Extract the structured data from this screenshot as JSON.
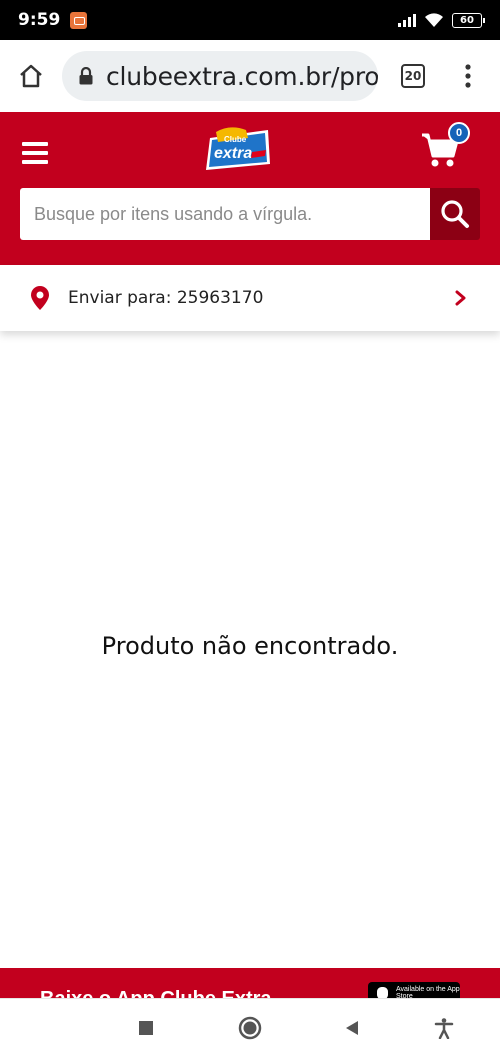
{
  "status_bar": {
    "time": "9:59",
    "battery": "60"
  },
  "browser": {
    "url": "clubeextra.com.br/pro",
    "tab_count": "20"
  },
  "header": {
    "logo_alt": "Clube Extra",
    "cart_count": "0",
    "search_placeholder": "Busque por itens usando a vírgula."
  },
  "location": {
    "label": "Enviar para: 25963170"
  },
  "main": {
    "message": "Produto não encontrado."
  },
  "app_banner": {
    "text": "Baixe o App Clube Extra",
    "store_badge": "Available on the App Store"
  },
  "colors": {
    "brand_red": "#c2001e",
    "search_button": "#8c0014",
    "badge_blue": "#1663b8"
  },
  "icons": [
    "home-icon",
    "lock-icon",
    "tabs-icon",
    "more-vert-icon",
    "hamburger-icon",
    "cart-icon",
    "search-icon",
    "location-pin-icon",
    "chevron-right-icon",
    "stop-icon",
    "home-circle-icon",
    "back-icon",
    "accessibility-icon"
  ]
}
